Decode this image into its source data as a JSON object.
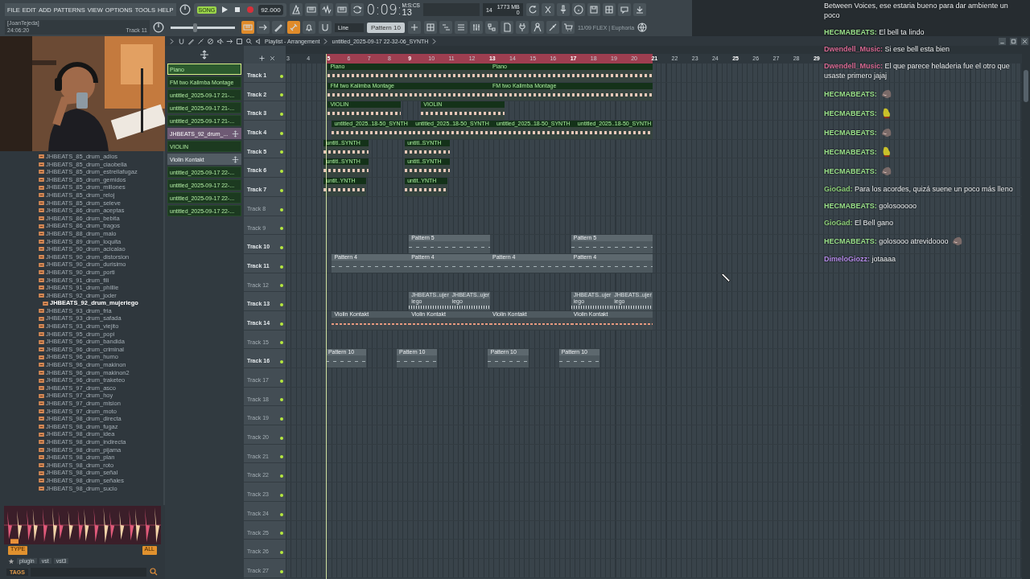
{
  "toolbar": {
    "menu": [
      "FILE",
      "EDIT",
      "ADD",
      "PATTERNS",
      "VIEW",
      "OPTIONS",
      "TOOLS",
      "HELP"
    ],
    "hint_title": "[JoanTejeda]",
    "hint_time": "24:06:20",
    "hint_track": "Track 11",
    "song_label": "SONG",
    "song_selected": true,
    "tempo": "92.000",
    "time": "0:09:",
    "time_cs": "13",
    "time_unit": "M:S:CS",
    "polyphony": "14",
    "memory": "1773 MB",
    "cpu_value": "0",
    "snap": "Line",
    "pattern": "Pattern 10",
    "pitch_slider": {
      "level": 0.37
    },
    "toggles": [
      {
        "on": true
      },
      {
        "on": false
      },
      {
        "on": false
      },
      {
        "on": true
      },
      {
        "on": false
      }
    ],
    "news": "11/09 FLEX | Euphoria"
  },
  "browser": {
    "items": [
      {
        "label": "JHBEATS_85_drum_adios",
        "selected": false
      },
      {
        "label": "JHBEATS_85_drum_ciaobella",
        "selected": false
      },
      {
        "label": "JHBEATS_85_drum_estrellafugaz",
        "selected": false
      },
      {
        "label": "JHBEATS_85_drum_gemidos",
        "selected": false
      },
      {
        "label": "JHBEATS_85_drum_millones",
        "selected": false
      },
      {
        "label": "JHBEATS_85_drum_reloj",
        "selected": false
      },
      {
        "label": "JHBEATS_85_drum_seleve",
        "selected": false
      },
      {
        "label": "JHBEATS_86_drum_aceptas",
        "selected": false
      },
      {
        "label": "JHBEATS_86_drum_bebita",
        "selected": false
      },
      {
        "label": "JHBEATS_86_drum_tragos",
        "selected": false
      },
      {
        "label": "JHBEATS_88_drum_malo",
        "selected": false
      },
      {
        "label": "JHBEATS_89_drum_loquita",
        "selected": false
      },
      {
        "label": "JHBEATS_90_drum_acicalao",
        "selected": false
      },
      {
        "label": "JHBEATS_90_drum_distorsion",
        "selected": false
      },
      {
        "label": "JHBEATS_90_drum_durisimo",
        "selected": false
      },
      {
        "label": "JHBEATS_90_drum_porti",
        "selected": false
      },
      {
        "label": "JHBEATS_91_drum_fili",
        "selected": false
      },
      {
        "label": "JHBEATS_91_drum_phillie",
        "selected": false
      },
      {
        "label": "JHBEATS_92_drum_joder",
        "selected": false
      },
      {
        "label": "JHBEATS_92_drum_mujeriego",
        "selected": true
      },
      {
        "label": "JHBEATS_93_drum_fria",
        "selected": false
      },
      {
        "label": "JHBEATS_93_drum_safada",
        "selected": false
      },
      {
        "label": "JHBEATS_93_drum_viejito",
        "selected": false
      },
      {
        "label": "JHBEATS_95_drum_popi",
        "selected": false
      },
      {
        "label": "JHBEATS_96_drum_bandida",
        "selected": false
      },
      {
        "label": "JHBEATS_96_drum_criminal",
        "selected": false
      },
      {
        "label": "JHBEATS_96_drum_humo",
        "selected": false
      },
      {
        "label": "JHBEATS_96_drum_makinon",
        "selected": false
      },
      {
        "label": "JHBEATS_96_drum_makinon2",
        "selected": false
      },
      {
        "label": "JHBEATS_96_drum_traketeo",
        "selected": false
      },
      {
        "label": "JHBEATS_97_drum_asco",
        "selected": false
      },
      {
        "label": "JHBEATS_97_drum_hoy",
        "selected": false
      },
      {
        "label": "JHBEATS_97_drum_mision",
        "selected": false
      },
      {
        "label": "JHBEATS_97_drum_moto",
        "selected": false
      },
      {
        "label": "JHBEATS_98_drum_directa",
        "selected": false
      },
      {
        "label": "JHBEATS_98_drum_fugaz",
        "selected": false
      },
      {
        "label": "JHBEATS_98_drum_idea",
        "selected": false
      },
      {
        "label": "JHBEATS_98_drum_indirecta",
        "selected": false
      },
      {
        "label": "JHBEATS_98_drum_pijama",
        "selected": false
      },
      {
        "label": "JHBEATS_98_drum_plan",
        "selected": false
      },
      {
        "label": "JHBEATS_98_drum_roto",
        "selected": false
      },
      {
        "label": "JHBEATS_98_drum_señal",
        "selected": false
      },
      {
        "label": "JHBEATS_98_drum_señales",
        "selected": false
      },
      {
        "label": "JHBEATS_98_drum_sucio",
        "selected": false
      }
    ],
    "type_label": "TYPE",
    "all_label": "ALL",
    "filters": [
      "plugin",
      "vst",
      "vst3"
    ],
    "tags_label": "TAGS"
  },
  "playlist": {
    "title": "Playlist - Arrangement",
    "project": "untitled_2025-09-17 22-32-06_SYNTH",
    "ruler": [
      "3",
      "4",
      "5",
      "6",
      "7",
      "8",
      "9",
      "10",
      "11",
      "12",
      "13",
      "14",
      "15",
      "16",
      "17",
      "18",
      "19",
      "20",
      "21",
      "22",
      "23",
      "24",
      "25",
      "26",
      "27",
      "28",
      "29"
    ],
    "picker": [
      {
        "label": "Piano",
        "kind": "audio",
        "selected": true
      },
      {
        "label": "FM two Kalimba Montage",
        "kind": "audio",
        "selected": false
      },
      {
        "label": "untitled_2025-09-17 21-...",
        "kind": "audio",
        "selected": false
      },
      {
        "label": "untitled_2025-09-17 21-...",
        "kind": "audio",
        "selected": false
      },
      {
        "label": "untitled_2025-09-17 21-...",
        "kind": "audio",
        "selected": false
      },
      {
        "label": "JHBEATS_92_drum_...",
        "kind": "sample",
        "selected": false
      },
      {
        "label": "VIOLIN",
        "kind": "audio",
        "selected": false
      },
      {
        "label": "Violin Kontakt",
        "kind": "pattern",
        "selected": false
      },
      {
        "label": "untitled_2025-09-17 22-...",
        "kind": "audio",
        "selected": false
      },
      {
        "label": "untitled_2025-09-17 22-...",
        "kind": "audio",
        "selected": false
      },
      {
        "label": "untitled_2025-09-17 22-...",
        "kind": "audio",
        "selected": false
      },
      {
        "label": "untitled_2025-09-17 22-...",
        "kind": "audio",
        "selected": false
      }
    ],
    "tracks": [
      {
        "name": "Track 1",
        "dimmed": false,
        "clips": [
          {
            "label": "Piano",
            "kind": "audio"
          },
          {
            "label": "Piano",
            "kind": "audio"
          }
        ]
      },
      {
        "name": "Track 2",
        "dimmed": false,
        "clips": [
          {
            "label": "FM two Kalimba Montage",
            "kind": "audio"
          },
          {
            "label": "FM two Kalimba Montage",
            "kind": "audio"
          }
        ]
      },
      {
        "name": "Track 3",
        "dimmed": false,
        "clips": [
          {
            "label": "VIOLIN",
            "kind": "audio"
          },
          {
            "label": "VIOLIN",
            "kind": "audio"
          }
        ]
      },
      {
        "name": "Track 4",
        "dimmed": false,
        "clips": [
          {
            "label": "untitled_2025..18-50_SYNTH",
            "kind": "audio"
          },
          {
            "label": "untitled_2025..18-50_SYNTH",
            "kind": "audio"
          },
          {
            "label": "untitled_2025..18-50_SYNTH",
            "kind": "audio"
          },
          {
            "label": "untitled_2025..18-50_SYNTH",
            "kind": "audio"
          }
        ]
      },
      {
        "name": "Track 5",
        "dimmed": false,
        "clips": [
          {
            "label": "untitl..SYNTH",
            "kind": "audio"
          },
          {
            "label": "untitl..SYNTH",
            "kind": "audio"
          }
        ]
      },
      {
        "name": "Track 6",
        "dimmed": false,
        "clips": [
          {
            "label": "untitl..SYNTH",
            "kind": "audio"
          },
          {
            "label": "untitl..SYNTH",
            "kind": "audio"
          }
        ]
      },
      {
        "name": "Track 7",
        "dimmed": false,
        "clips": [
          {
            "label": "untit..YNTH",
            "kind": "audio"
          },
          {
            "label": "untit..YNTH",
            "kind": "audio"
          }
        ]
      },
      {
        "name": "Track 8",
        "dimmed": true
      },
      {
        "name": "Track 9",
        "dimmed": true
      },
      {
        "name": "Track 10",
        "dimmed": false,
        "clips": [
          {
            "label": "Pattern 5",
            "kind": "pattern"
          },
          {
            "label": "Pattern 5",
            "kind": "pattern"
          }
        ]
      },
      {
        "name": "Track 11",
        "dimmed": false,
        "clips": [
          {
            "label": "Pattern 4",
            "kind": "pattern"
          },
          {
            "label": "Pattern 4",
            "kind": "pattern"
          },
          {
            "label": "Pattern 4",
            "kind": "pattern"
          },
          {
            "label": "Pattern 4",
            "kind": "pattern"
          }
        ]
      },
      {
        "name": "Track 12",
        "dimmed": true
      },
      {
        "name": "Track 13",
        "dimmed": false,
        "clips": [
          {
            "label": "JHBEATS..ujeriego",
            "kind": "sample"
          },
          {
            "label": "JHBEATS..ujeriego",
            "kind": "sample"
          },
          {
            "label": "JHBEATS..ujeriego",
            "kind": "sample"
          },
          {
            "label": "JHBEATS..ujeriego",
            "kind": "sample"
          }
        ]
      },
      {
        "name": "Track 14",
        "dimmed": false,
        "clips": [
          {
            "label": "Violin Kontakt",
            "kind": "recording"
          },
          {
            "label": "Violin Kontakt",
            "kind": "recording"
          },
          {
            "label": "Violin Kontakt",
            "kind": "recording"
          },
          {
            "label": "Violin Kontakt",
            "kind": "recording"
          }
        ]
      },
      {
        "name": "Track 15",
        "dimmed": true
      },
      {
        "name": "Track 16",
        "dimmed": false,
        "clips": [
          {
            "label": "Pattern 10",
            "kind": "pattern"
          },
          {
            "label": "Pattern 10",
            "kind": "pattern"
          },
          {
            "label": "Pattern 10",
            "kind": "pattern"
          },
          {
            "label": "Pattern 10",
            "kind": "pattern"
          }
        ]
      },
      {
        "name": "Track 17",
        "dimmed": true
      },
      {
        "name": "Track 18",
        "dimmed": true
      },
      {
        "name": "Track 19",
        "dimmed": true
      },
      {
        "name": "Track 20",
        "dimmed": true
      },
      {
        "name": "Track 21",
        "dimmed": true
      },
      {
        "name": "Track 22",
        "dimmed": true
      },
      {
        "name": "Track 23",
        "dimmed": true
      },
      {
        "name": "Track 24",
        "dimmed": true
      },
      {
        "name": "Track 25",
        "dimmed": true
      },
      {
        "name": "Track 26",
        "dimmed": true
      },
      {
        "name": "Track 27",
        "dimmed": true
      }
    ]
  },
  "chat": [
    {
      "text": "Between Voices, ese estaria bueno para dar ambiente un poco"
    },
    {
      "user": "HECMABEATS:",
      "color": "#9be28b",
      "text": "El bell ta lindo"
    },
    {
      "user": "Dwendell_Music:",
      "color": "#d86a94",
      "text": "Si ese bell esta bien"
    },
    {
      "user": "Dwendell_Music:",
      "color": "#d86a94",
      "text": "El que parece heladeria fue el otro que usaste primero jajaj"
    },
    {
      "user": "HECMABEATS:",
      "color": "#9be28b",
      "emote": {
        "kind": "fish"
      }
    },
    {
      "user": "HECMABEATS:",
      "color": "#9be28b",
      "emote": {
        "kind": "bird"
      }
    },
    {
      "user": "HECMABEATS:",
      "color": "#9be28b",
      "emote": {
        "kind": "fish"
      }
    },
    {
      "user": "HECMABEATS:",
      "color": "#9be28b",
      "emote": {
        "kind": "bird"
      }
    },
    {
      "user": "HECMABEATS:",
      "color": "#9be28b",
      "emote": {
        "kind": "fish"
      }
    },
    {
      "user": "GioGad:",
      "color": "#8fd07a",
      "text": "Para los acordes, quizá suene un poco más lleno"
    },
    {
      "user": "HECMABEATS:",
      "color": "#9be28b",
      "text": "golosooooo"
    },
    {
      "user": "GioGad:",
      "color": "#8fd07a",
      "text": "El Bell gano"
    },
    {
      "user": "HECMABEATS:",
      "color": "#9be28b",
      "text": "golosooo atrevidoooo",
      "emote": {
        "kind": "fish"
      }
    },
    {
      "user": "DimeloGiozz:",
      "color": "#b48ae8",
      "text": "jotaaaa"
    }
  ]
}
